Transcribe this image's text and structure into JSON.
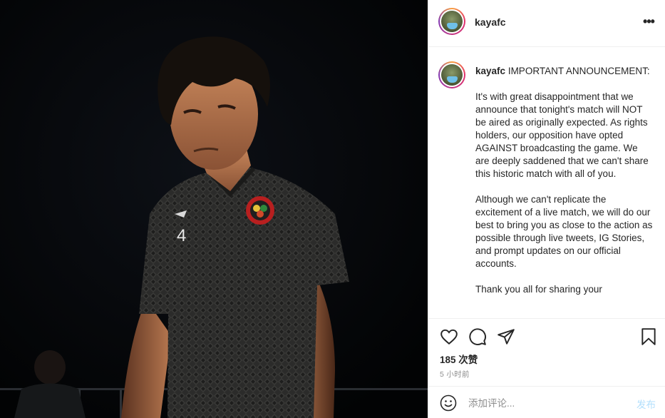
{
  "post": {
    "username": "kayafc",
    "more_label": "•••"
  },
  "caption": {
    "username": "kayafc",
    "paragraphs": [
      "IMPORTANT ANNOUNCEMENT:",
      "It's with great disappointment that we announce that tonight's match will NOT be aired as originally expected. As rights holders, our opposition have opted AGAINST broadcasting the game. We are deeply saddened that we can't share this historic match with all of you.",
      "Although we can't replicate the excitement of a live match, we will do our best to bring you as close to the action as possible through live tweets, IG Stories, and prompt updates on our official accounts.",
      "Thank you all for sharing your"
    ]
  },
  "actions": {
    "likes": "185 次赞",
    "time_ago": "5 小时前"
  },
  "comment": {
    "placeholder": "添加评论...",
    "post_label": "发布"
  },
  "photo": {
    "jersey_number": "4"
  },
  "colors": {
    "link_disabled": "#b2dffc",
    "muted_text": "#8e8e8e",
    "border": "#efefef"
  }
}
